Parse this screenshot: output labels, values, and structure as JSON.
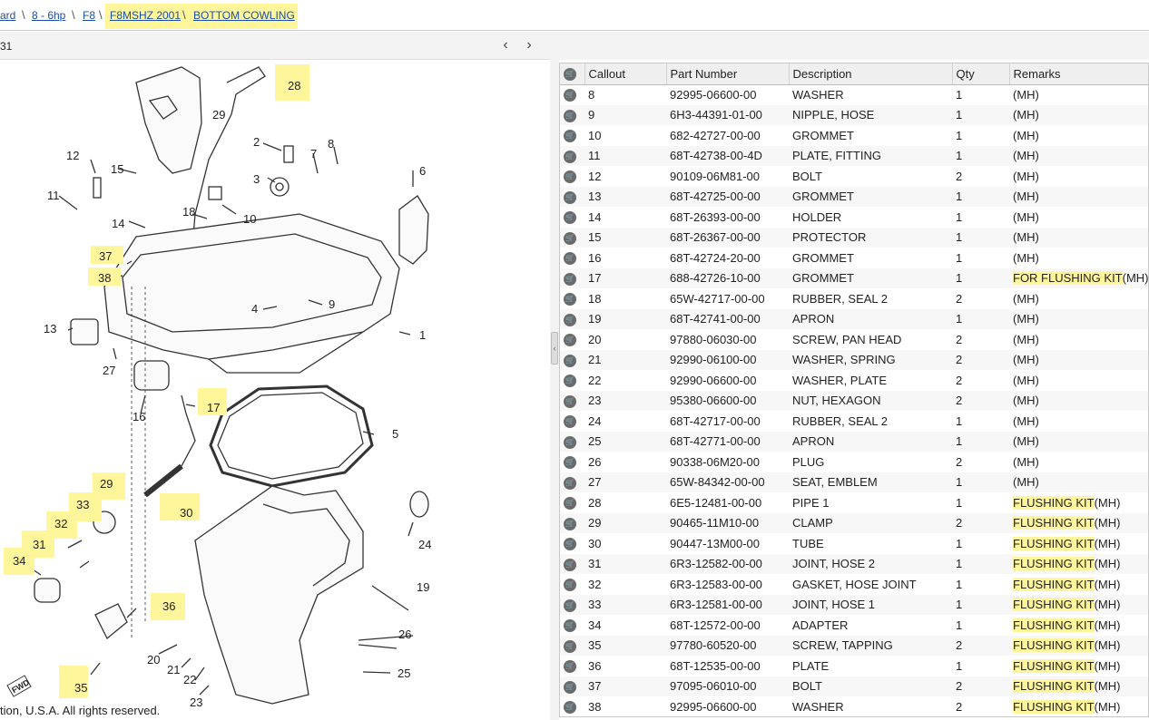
{
  "breadcrumb": {
    "items": [
      "ard",
      "8 - 6hp",
      "F8",
      "F8MSHZ 2001",
      "BOTTOM COWLING"
    ],
    "separator": "\\"
  },
  "left_header": {
    "title": "31",
    "prev_icon": "chevron-left-icon",
    "next_icon": "chevron-right-icon"
  },
  "copyright": "tion, U.S.A. All rights reserved.",
  "diagram_callouts": [
    "28",
    "29",
    "2",
    "7",
    "8",
    "6",
    "12",
    "15",
    "3",
    "11",
    "18",
    "10",
    "14",
    "37",
    "38",
    "4",
    "9",
    "1",
    "13",
    "27",
    "16",
    "17",
    "5",
    "29",
    "33",
    "30",
    "32",
    "31",
    "34",
    "24",
    "36",
    "19",
    "26",
    "20",
    "21",
    "22",
    "25",
    "35",
    "23"
  ],
  "diagram_fwd": "FWD",
  "table": {
    "columns": [
      "",
      "Callout",
      "Part Number",
      "Description",
      "Qty",
      "Remarks"
    ],
    "rows": [
      {
        "callout": "8",
        "part": "92995-06600-00",
        "desc": "WASHER",
        "qty": "1",
        "hl": "",
        "rem": "(MH)"
      },
      {
        "callout": "9",
        "part": "6H3-44391-01-00",
        "desc": "NIPPLE, HOSE",
        "qty": "1",
        "hl": "",
        "rem": "(MH)"
      },
      {
        "callout": "10",
        "part": "682-42727-00-00",
        "desc": "GROMMET",
        "qty": "1",
        "hl": "",
        "rem": "(MH)"
      },
      {
        "callout": "11",
        "part": "68T-42738-00-4D",
        "desc": "PLATE, FITTING",
        "qty": "1",
        "hl": "",
        "rem": "(MH)"
      },
      {
        "callout": "12",
        "part": "90109-06M81-00",
        "desc": "BOLT",
        "qty": "2",
        "hl": "",
        "rem": "(MH)"
      },
      {
        "callout": "13",
        "part": "68T-42725-00-00",
        "desc": "GROMMET",
        "qty": "1",
        "hl": "",
        "rem": "(MH)"
      },
      {
        "callout": "14",
        "part": "68T-26393-00-00",
        "desc": "HOLDER",
        "qty": "1",
        "hl": "",
        "rem": "(MH)"
      },
      {
        "callout": "15",
        "part": "68T-26367-00-00",
        "desc": "PROTECTOR",
        "qty": "1",
        "hl": "",
        "rem": "(MH)"
      },
      {
        "callout": "16",
        "part": "68T-42724-20-00",
        "desc": "GROMMET",
        "qty": "1",
        "hl": "",
        "rem": "(MH)"
      },
      {
        "callout": "17",
        "part": "688-42726-10-00",
        "desc": "GROMMET",
        "qty": "1",
        "hl": "FOR FLUSHING KIT",
        "rem": "(MH)"
      },
      {
        "callout": "18",
        "part": "65W-42717-00-00",
        "desc": "RUBBER, SEAL 2",
        "qty": "2",
        "hl": "",
        "rem": "(MH)"
      },
      {
        "callout": "19",
        "part": "68T-42741-00-00",
        "desc": "APRON",
        "qty": "1",
        "hl": "",
        "rem": "(MH)"
      },
      {
        "callout": "20",
        "part": "97880-06030-00",
        "desc": "SCREW, PAN HEAD",
        "qty": "2",
        "hl": "",
        "rem": "(MH)"
      },
      {
        "callout": "21",
        "part": "92990-06100-00",
        "desc": "WASHER, SPRING",
        "qty": "2",
        "hl": "",
        "rem": "(MH)"
      },
      {
        "callout": "22",
        "part": "92990-06600-00",
        "desc": "WASHER, PLATE",
        "qty": "2",
        "hl": "",
        "rem": "(MH)"
      },
      {
        "callout": "23",
        "part": "95380-06600-00",
        "desc": "NUT, HEXAGON",
        "qty": "2",
        "hl": "",
        "rem": "(MH)"
      },
      {
        "callout": "24",
        "part": "68T-42717-00-00",
        "desc": "RUBBER, SEAL 2",
        "qty": "1",
        "hl": "",
        "rem": "(MH)"
      },
      {
        "callout": "25",
        "part": "68T-42771-00-00",
        "desc": "APRON",
        "qty": "1",
        "hl": "",
        "rem": "(MH)"
      },
      {
        "callout": "26",
        "part": "90338-06M20-00",
        "desc": "PLUG",
        "qty": "2",
        "hl": "",
        "rem": "(MH)"
      },
      {
        "callout": "27",
        "part": "65W-84342-00-00",
        "desc": "SEAT, EMBLEM",
        "qty": "1",
        "hl": "",
        "rem": "(MH)"
      },
      {
        "callout": "28",
        "part": "6E5-12481-00-00",
        "desc": "PIPE 1",
        "qty": "1",
        "hl": "FLUSHING KIT",
        "rem": "(MH)"
      },
      {
        "callout": "29",
        "part": "90465-11M10-00",
        "desc": "CLAMP",
        "qty": "2",
        "hl": "FLUSHING KIT",
        "rem": "(MH)"
      },
      {
        "callout": "30",
        "part": "90447-13M00-00",
        "desc": "TUBE",
        "qty": "1",
        "hl": "FLUSHING KIT",
        "rem": "(MH)"
      },
      {
        "callout": "31",
        "part": "6R3-12582-00-00",
        "desc": "JOINT, HOSE 2",
        "qty": "1",
        "hl": "FLUSHING KIT",
        "rem": "(MH)"
      },
      {
        "callout": "32",
        "part": "6R3-12583-00-00",
        "desc": "GASKET, HOSE JOINT",
        "qty": "1",
        "hl": "FLUSHING KIT",
        "rem": "(MH)"
      },
      {
        "callout": "33",
        "part": "6R3-12581-00-00",
        "desc": "JOINT, HOSE 1",
        "qty": "1",
        "hl": "FLUSHING KIT",
        "rem": "(MH)"
      },
      {
        "callout": "34",
        "part": "68T-12572-00-00",
        "desc": "ADAPTER",
        "qty": "1",
        "hl": "FLUSHING KIT",
        "rem": "(MH)"
      },
      {
        "callout": "35",
        "part": "97780-60520-00",
        "desc": "SCREW, TAPPING",
        "qty": "2",
        "hl": "FLUSHING KIT",
        "rem": "(MH)"
      },
      {
        "callout": "36",
        "part": "68T-12535-00-00",
        "desc": "PLATE",
        "qty": "1",
        "hl": "FLUSHING KIT",
        "rem": "(MH)"
      },
      {
        "callout": "37",
        "part": "97095-06010-00",
        "desc": "BOLT",
        "qty": "2",
        "hl": "FLUSHING KIT",
        "rem": "(MH)"
      },
      {
        "callout": "38",
        "part": "92995-06600-00",
        "desc": "WASHER",
        "qty": "2",
        "hl": "FLUSHING KIT",
        "rem": "(MH)"
      }
    ]
  },
  "colors": {
    "highlight": "#fff59a",
    "link": "#1a4fa8",
    "cart": "#6b6b6b"
  },
  "icons": {
    "cart": "cart-icon",
    "collapse": "collapse-arrow-icon"
  }
}
